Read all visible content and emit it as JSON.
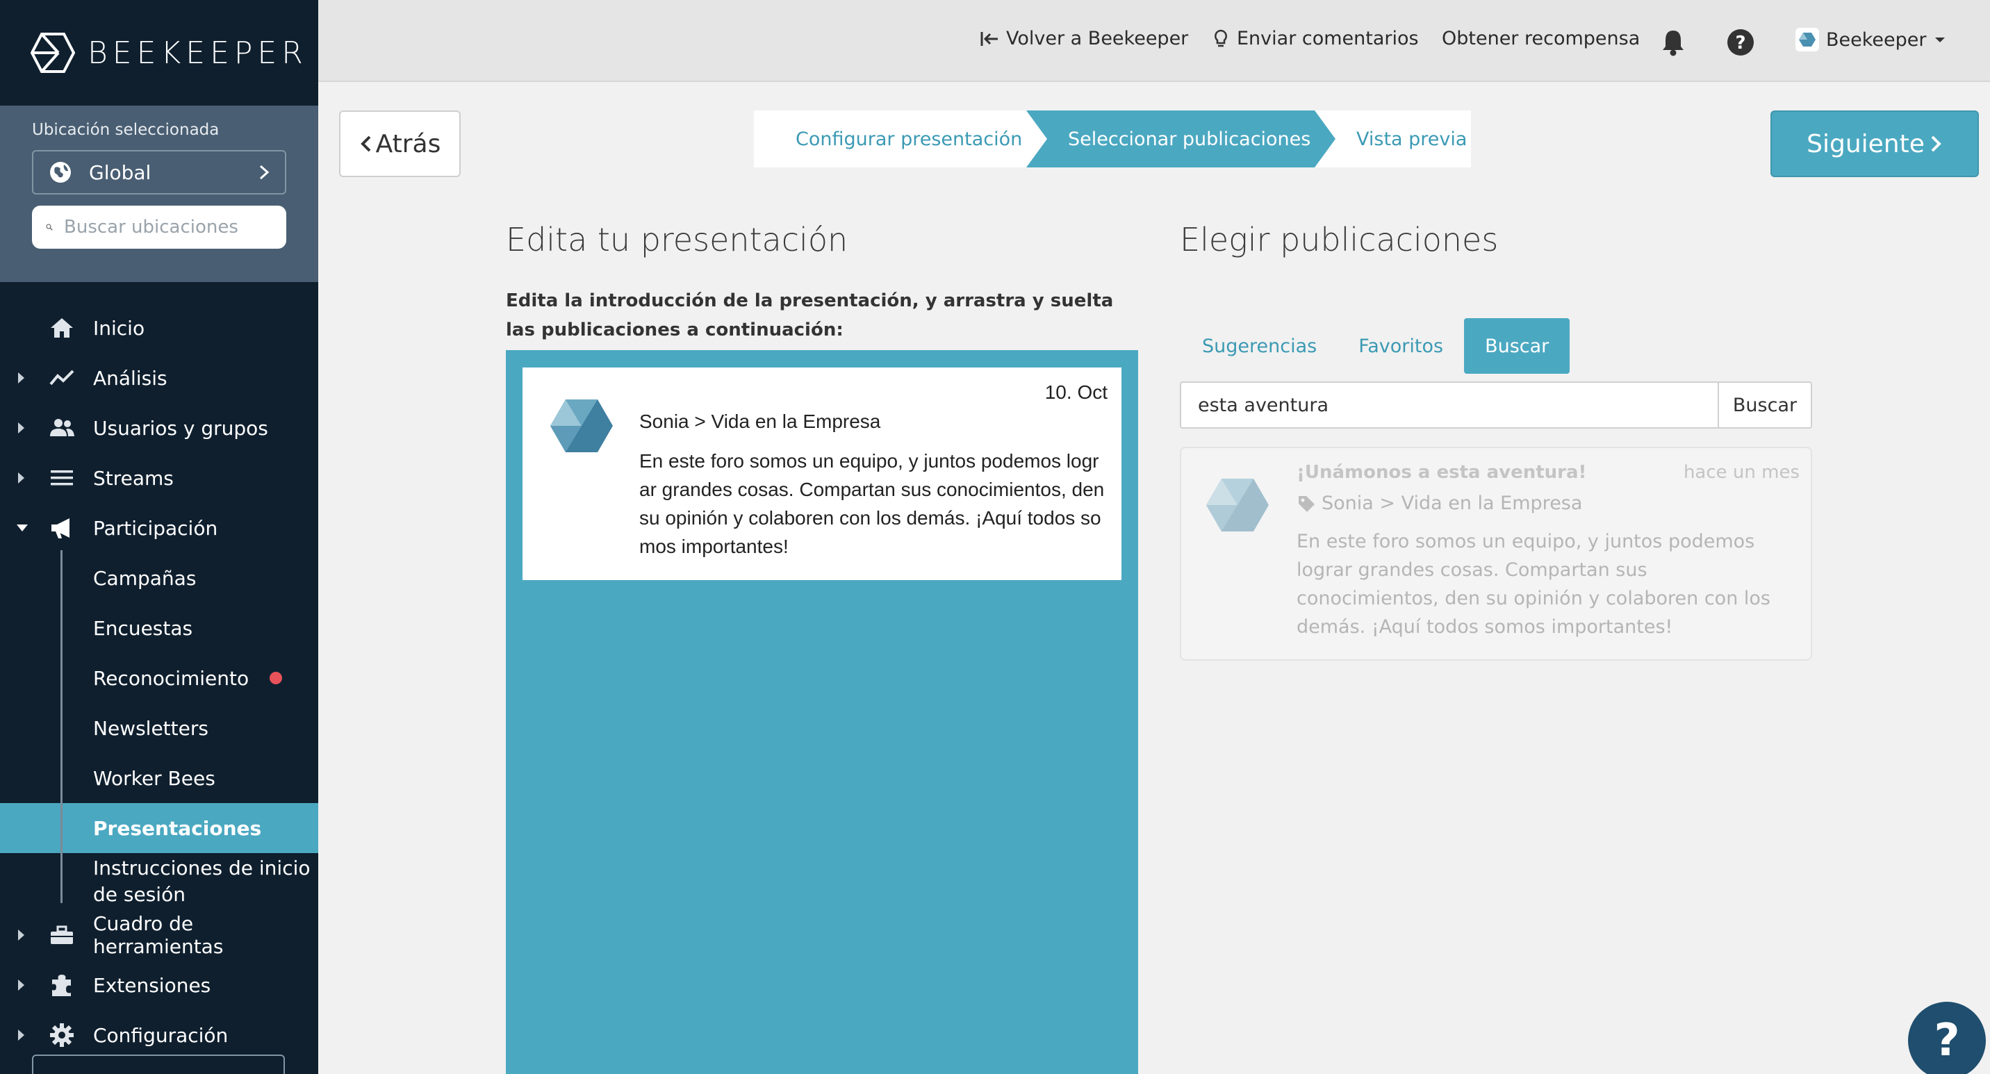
{
  "brand": {
    "name": "BEEKEEPER"
  },
  "location": {
    "label": "Ubicación seleccionada",
    "selected": "Global",
    "search_placeholder": "Buscar ubicaciones"
  },
  "nav": {
    "inicio": "Inicio",
    "analisis": "Análisis",
    "usuarios": "Usuarios y grupos",
    "streams": "Streams",
    "participacion": "Participación",
    "sub": {
      "campanas": "Campañas",
      "encuestas": "Encuestas",
      "reconocimiento": "Reconocimiento",
      "newsletters": "Newsletters",
      "worker_bees": "Worker Bees",
      "presentaciones": "Presentaciones",
      "instrucciones": "Instrucciones de inicio de sesión"
    },
    "herramientas": "Cuadro de herramientas",
    "extensiones": "Extensiones",
    "configuracion": "Configuración"
  },
  "topbar": {
    "back_link": "Volver a Beekeeper",
    "feedback": "Enviar comentarios",
    "reward": "Obtener recompensa",
    "account": "Beekeeper"
  },
  "wizard": {
    "back": "Atrás",
    "next": "Siguiente",
    "steps": [
      "Configurar presentación",
      "Seleccionar publicaciones",
      "Vista previa"
    ],
    "active_step": 1
  },
  "left_panel": {
    "title": "Edita tu presentación",
    "instructions": "Edita la introducción de la presentación, y arrastra y suelta las publicaciones a continuación:",
    "post": {
      "date": "10. Oct",
      "crumb": "Sonia > Vida en la Empresa",
      "body": "En este foro somos un equipo, y juntos podemos lograr grandes cosas. Compartan sus conocimientos, den su opinión y colaboren con los demás. ¡Aquí todos somos importantes!"
    }
  },
  "right_panel": {
    "title": "Elegir publicaciones",
    "tabs": [
      "Sugerencias",
      "Favoritos",
      "Buscar"
    ],
    "active_tab": "Buscar",
    "search_value": "esta aventura",
    "search_button": "Buscar",
    "result": {
      "title": "¡Unámonos a esta aventura!",
      "time": "hace un mes",
      "crumb": "Sonia > Vida en la Empresa",
      "body": "En este foro somos un equipo, y juntos podemos lograr grandes cosas. Compartan sus conocimientos, den su opinión y colaboren con los demás. ¡Aquí todos somos importantes!"
    }
  },
  "help": {
    "glyph": "?"
  },
  "colors": {
    "sidebar_bg": "#0f1f2e",
    "accent": "#4ba8c1",
    "location_panel": "#495e72",
    "notification_dot": "#e8525a"
  }
}
